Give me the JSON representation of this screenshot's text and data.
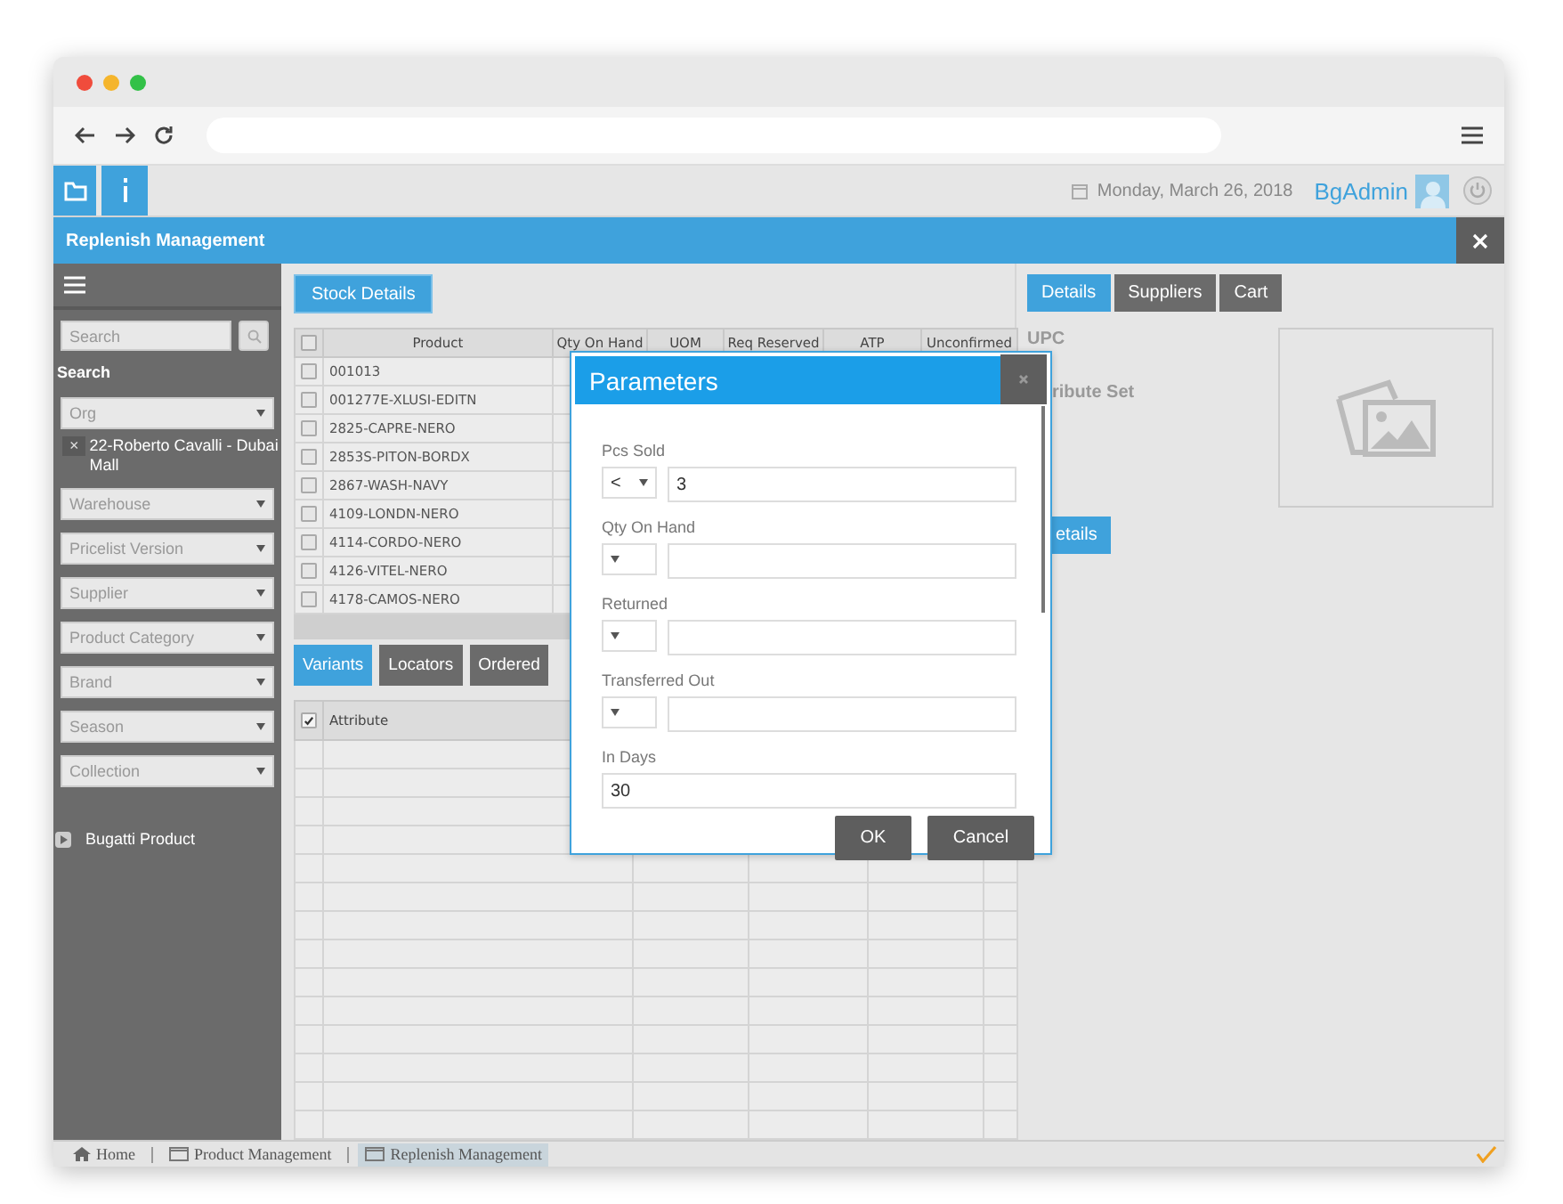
{
  "header": {
    "date": "Monday, March 26, 2018",
    "user": "BgAdmin"
  },
  "title_bar": {
    "title": "Replenish Management"
  },
  "sidebar": {
    "search": {
      "placeholder": "Search"
    },
    "search_label": "Search",
    "filters": [
      {
        "placeholder": "Org",
        "chip": "22-Roberto Cavalli - Dubai Mall",
        "chip_remove": "×"
      },
      {
        "placeholder": "Warehouse"
      },
      {
        "placeholder": "Pricelist Version"
      },
      {
        "placeholder": "Supplier"
      },
      {
        "placeholder": "Product Category"
      },
      {
        "placeholder": "Brand"
      },
      {
        "placeholder": "Season"
      },
      {
        "placeholder": "Collection"
      }
    ],
    "tree": [
      {
        "label": "Bugatti Product",
        "expanded": false
      }
    ]
  },
  "stock": {
    "button": "Stock Details",
    "header_checked": false,
    "columns": [
      "Product",
      "Qty On Hand",
      "UOM",
      "Req Reserved",
      "ATP",
      "Unconfirmed"
    ],
    "rows": [
      {
        "product": "001013",
        "checked": false
      },
      {
        "product": "001277E-XLUSI-EDITN",
        "checked": false
      },
      {
        "product": "2825-CAPRE-NERO",
        "checked": false
      },
      {
        "product": "2853S-PITON-BORDX",
        "checked": false
      },
      {
        "product": "2867-WASH-NAVY",
        "checked": false
      },
      {
        "product": "4109-LONDN-NERO",
        "checked": false
      },
      {
        "product": "4114-CORDO-NERO",
        "checked": false
      },
      {
        "product": "4126-VITEL-NERO",
        "checked": false
      },
      {
        "product": "4178-CAMOS-NERO",
        "checked": false
      }
    ]
  },
  "lower_tabs": [
    {
      "label": "Variants",
      "selected": true
    },
    {
      "label": "Locators",
      "selected": false
    },
    {
      "label": "Ordered",
      "selected": false
    }
  ],
  "attribute_grid": {
    "header_checked": true,
    "columns": [
      "Attribute"
    ]
  },
  "details": {
    "tabs": [
      {
        "label": "Details",
        "selected": true
      },
      {
        "label": "Suppliers",
        "selected": false
      },
      {
        "label": "Cart",
        "selected": false
      }
    ],
    "upc_label": "UPC",
    "attribute_label": "ribute Set",
    "button": "etails"
  },
  "dialog": {
    "title": "Parameters",
    "fields": [
      {
        "kind": "compare",
        "label": "Pcs Sold",
        "operator": "<",
        "value": "3"
      },
      {
        "kind": "compare",
        "label": "Qty On Hand"
      },
      {
        "kind": "compare",
        "label": "Returned"
      },
      {
        "kind": "compare",
        "label": "Transferred Out"
      },
      {
        "kind": "plain",
        "label": "In Days",
        "value": "30"
      }
    ],
    "buttons": [
      "OK",
      "Cancel"
    ]
  },
  "footer": {
    "tabs": [
      {
        "kind": "home",
        "label": "Home",
        "selected": false
      },
      {
        "kind": "window",
        "label": "Product Management",
        "selected": false
      },
      {
        "kind": "window",
        "label": "Replenish Management",
        "selected": true
      }
    ]
  }
}
